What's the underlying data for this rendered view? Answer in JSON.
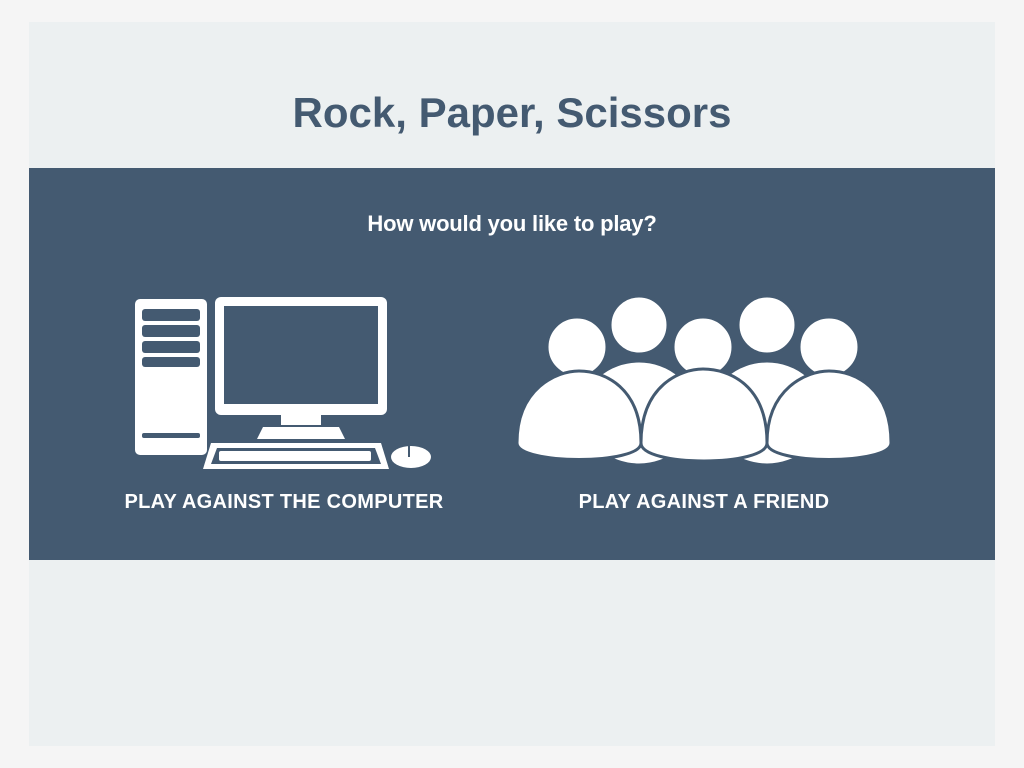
{
  "header": {
    "title": "Rock, Paper, Scissors"
  },
  "prompt": {
    "question": "How would you like to play?"
  },
  "options": [
    {
      "label": "PLAY AGAINST THE COMPUTER",
      "icon": "computer-icon"
    },
    {
      "label": "PLAY AGAINST A FRIEND",
      "icon": "group-people-icon"
    }
  ],
  "colors": {
    "page_background": "#f5f5f5",
    "frame_background": "#ecf0f1",
    "panel": "#445a71",
    "title_text": "#445a71",
    "icon_and_label": "#ffffff"
  }
}
